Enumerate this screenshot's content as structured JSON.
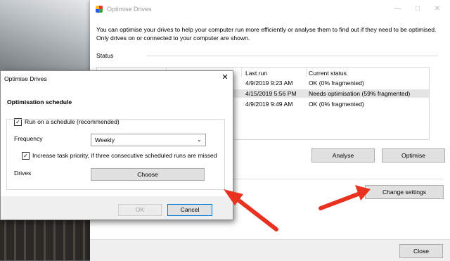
{
  "main": {
    "title": "Optimise Drives",
    "description": "You can optimise your drives to help your computer run more efficiently or analyse them to find out if they need to be optimised. Only drives on or connected to your computer are shown.",
    "status_label": "Status",
    "columns": [
      "Last run",
      "Current status"
    ],
    "rows": [
      {
        "last_run": "4/9/2019 9:23 AM",
        "status": "OK (0% fragmented)"
      },
      {
        "last_run": "4/15/2019 5:56 PM",
        "status": "Needs optimisation (59% fragmented)"
      },
      {
        "last_run": "4/9/2019 9:49 AM",
        "status": "OK (0% fragmented)"
      }
    ],
    "analyse_label": "Analyse",
    "optimise_label": "Optimise",
    "change_settings_label": "Change settings",
    "close_label": "Close"
  },
  "dialog": {
    "title": "Optimise Drives",
    "heading": "Optimisation schedule",
    "run_schedule_label": "Run on a schedule (recommended)",
    "run_schedule_checked": true,
    "frequency_label": "Frequency",
    "frequency_value": "Weekly",
    "priority_label": "Increase task priority, if three consecutive scheduled runs are missed",
    "priority_checked": true,
    "drives_label": "Drives",
    "choose_label": "Choose",
    "ok_label": "OK",
    "cancel_label": "Cancel"
  },
  "colors": {
    "annotation_arrow": "#e8321f",
    "selected_row": "#e5e5e5"
  },
  "icons": [
    "defrag-app-icon",
    "minimize-icon",
    "maximize-icon",
    "close-icon",
    "chevron-down-icon",
    "checkmark-icon",
    "red-arrow-annotation"
  ]
}
